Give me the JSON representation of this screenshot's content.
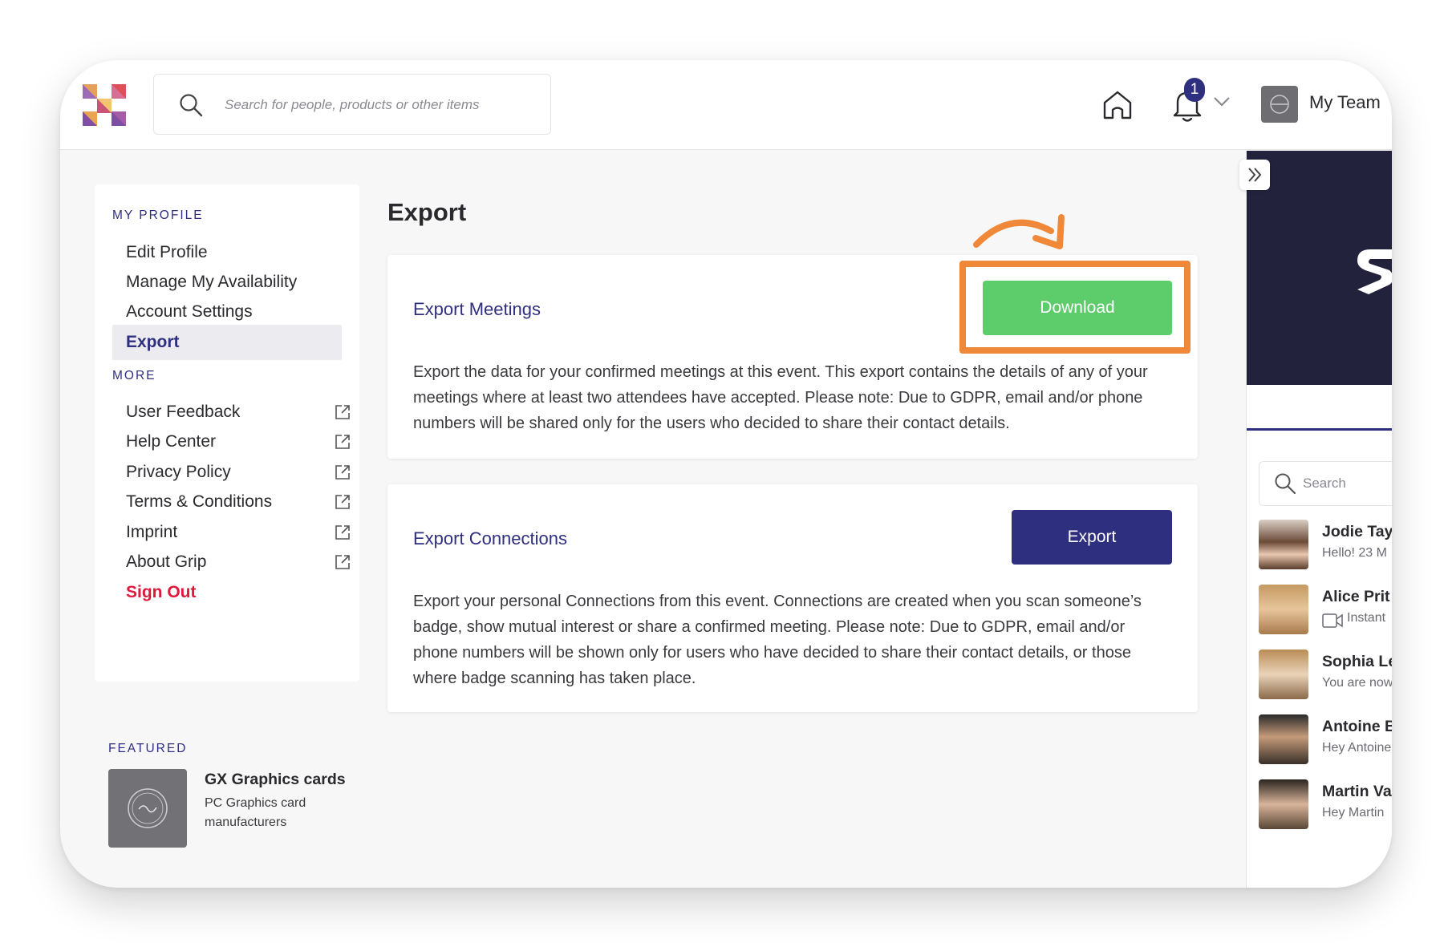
{
  "header": {
    "search_placeholder": "Search for people, products or other items",
    "notification_count": "1",
    "team_label": "My Team"
  },
  "sidebar": {
    "profile_title": "MY PROFILE",
    "profile_items": [
      "Edit Profile",
      "Manage My Availability",
      "Account Settings",
      "Export"
    ],
    "more_title": "MORE",
    "more_items": [
      "User Feedback",
      "Help Center",
      "Privacy Policy",
      "Terms & Conditions",
      "Imprint",
      "About Grip"
    ],
    "sign_out": "Sign Out"
  },
  "featured": {
    "title": "FEATURED",
    "name": "GX Graphics cards",
    "description": "PC Graphics card manufacturers"
  },
  "main": {
    "page_title": "Export",
    "meetings": {
      "title": "Export Meetings",
      "button": "Download",
      "description": "Export the data for your confirmed meetings at this event. This export contains the details of any of your meetings where at least two attendees have accepted. Please note: Due to GDPR, email and/or phone numbers will be shared only for the users who decided to share their contact details."
    },
    "connections": {
      "title": "Export Connections",
      "button": "Export",
      "description": "Export your personal Connections from this event. Connections are created when you scan someone’s badge, show mutual interest or share a confirmed meeting. Please note: Due to GDPR, email and/or phone numbers will be shown only for users who have decided to share their contact details, or those where badge scanning has taken place."
    }
  },
  "right_panel": {
    "search_placeholder": "Search",
    "chats": [
      {
        "name": "Jodie Tayl",
        "preview": "Hello!  23 M"
      },
      {
        "name": "Alice Prit",
        "preview": "Instant"
      },
      {
        "name": "Sophia Le",
        "preview": "You are now"
      },
      {
        "name": "Antoine B",
        "preview": "Hey Antoine"
      },
      {
        "name": "Martin Va",
        "preview": "Hey Martin"
      }
    ]
  },
  "colors": {
    "brand": "#2f2f7f",
    "download_green": "#5dcc6a",
    "highlight_orange": "#f0883a",
    "sign_out_red": "#e0183c"
  }
}
